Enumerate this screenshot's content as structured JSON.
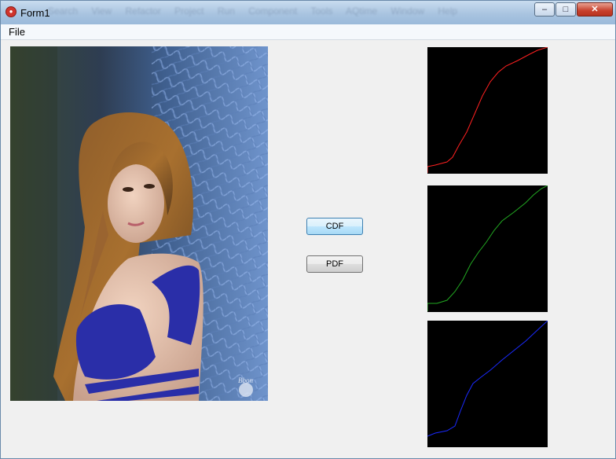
{
  "window": {
    "title": "Form1",
    "controls": {
      "minimize": "‒",
      "maximize": "□",
      "close": "✕"
    }
  },
  "menu": {
    "file": "File"
  },
  "buttons": {
    "cdf": "CDF",
    "pdf": "PDF"
  },
  "plots": {
    "red": {
      "color": "#ff2020"
    },
    "green": {
      "color": "#22aa22"
    },
    "blue": {
      "color": "#1a2aff"
    }
  }
}
